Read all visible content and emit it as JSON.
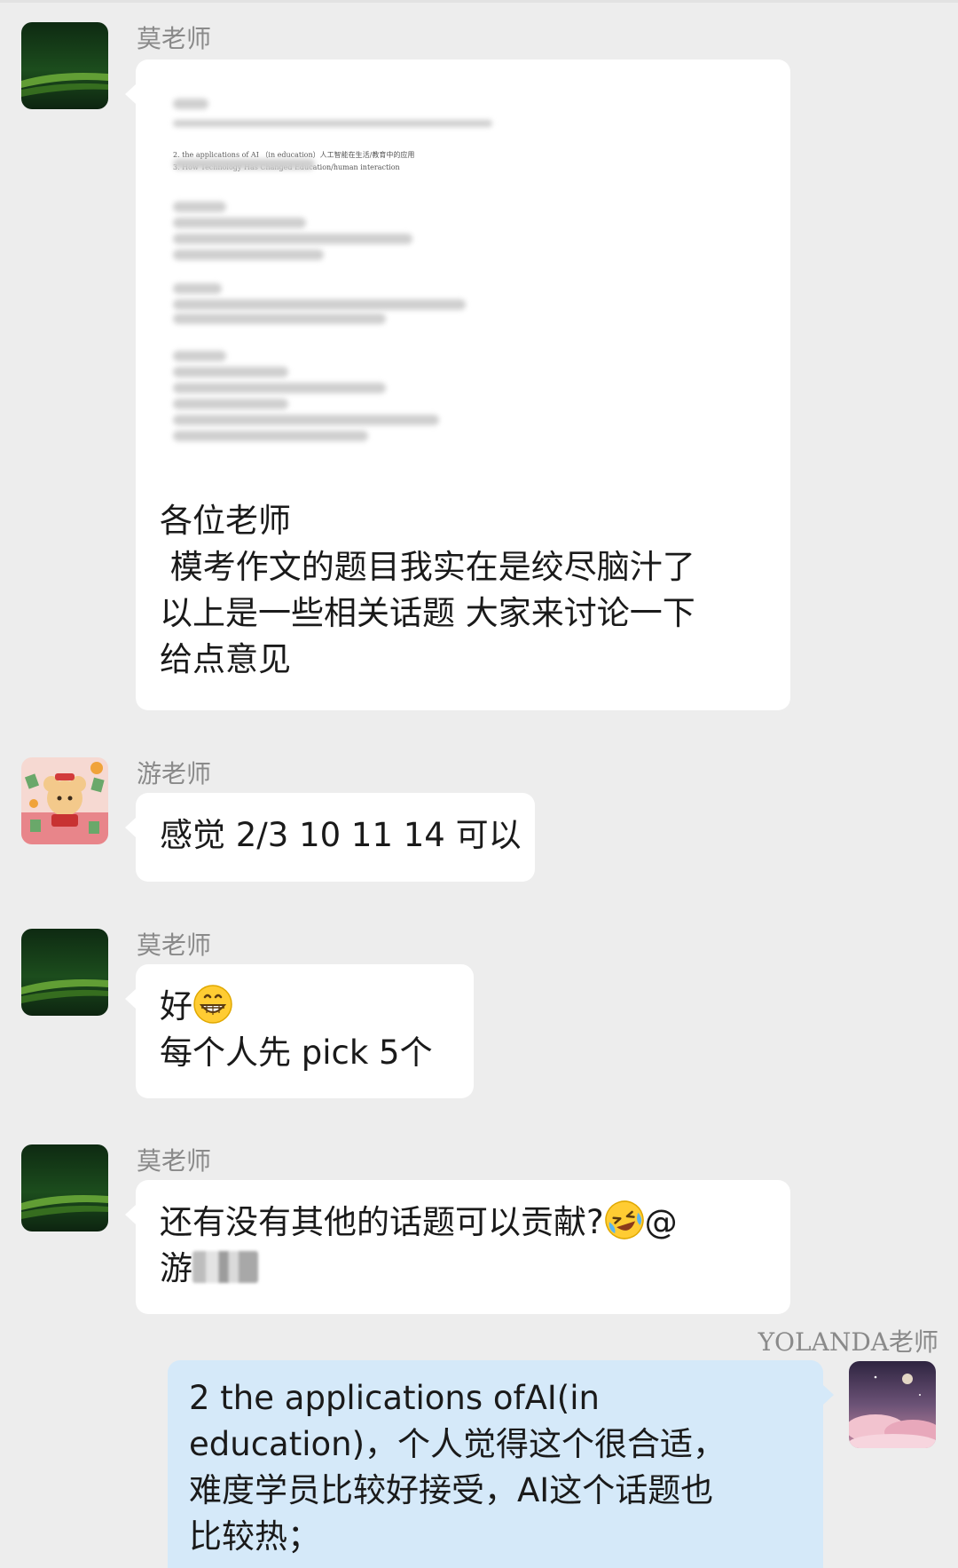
{
  "messages": [
    {
      "sender": "莫老师",
      "doc_preview": {
        "visible_line_1": "2. the applications of AI （in education）人工智能在生活/教育中的应用",
        "visible_line_2": "3. How Technology Has Changed Education/human interaction"
      },
      "lines": [
        "各位老师",
        " 模考作文的题目我实在是绞尽脑汁了",
        "以上是一些相关话题 大家来讨论一下",
        "给点意见"
      ]
    },
    {
      "sender": "游老师",
      "lines": [
        "感觉 2/3 10 11 14 可以"
      ]
    },
    {
      "sender": "莫老师",
      "line1_text": "好",
      "line1_emoji": "grinning-face-emoji",
      "line2": "每个人先 pick 5个"
    },
    {
      "sender": "莫老师",
      "line1_text": "还有没有其他的话题可以贡献?",
      "line1_emoji": "crying-laughing-emoji",
      "line1_suffix": "@",
      "line2_text": "游"
    },
    {
      "sender": "YOLANDA老师",
      "lines": [
        "2 the applications ofAI(in",
        "education)，个人觉得这个很合适，",
        "难度学员比较好接受，AI这个话题也",
        "比较热；"
      ]
    }
  ],
  "colors": {
    "background": "#ededed",
    "bubble_left": "#ffffff",
    "bubble_right": "#d5e9f9",
    "sender_name": "#8a8a8a",
    "text": "#1a1a1a"
  }
}
